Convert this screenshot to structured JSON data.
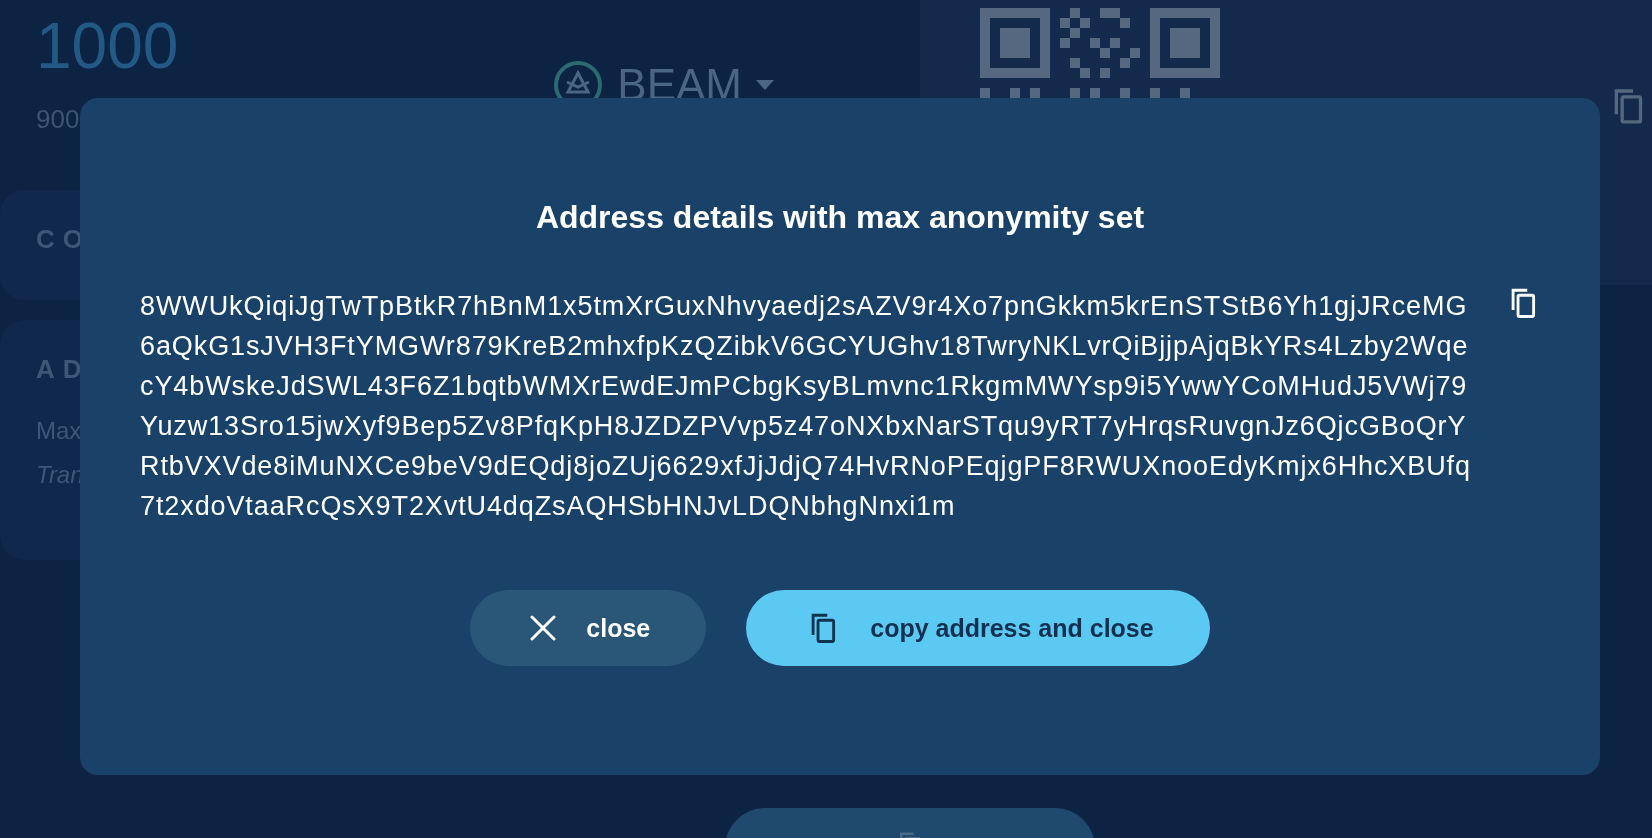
{
  "background": {
    "amount": "1000",
    "amount_secondary": "900",
    "currency": "BEAM",
    "section_1_title": "CO",
    "section_2_title": "AD",
    "section_2_label": "Max",
    "section_2_note": "Tran"
  },
  "dialog": {
    "title": "Address details with max anonymity set",
    "address": "8WWUkQiqiJgTwTpBtkR7hBnM1x5tmXrGuxNhvyaedj2sAZV9r4Xo7pnGkkm5krEnSTStB6Yh1gjJRceMG6aQkG1sJVH3FtYMGWr879KreB2mhxfpKzQZibkV6GCYUGhv18TwryNKLvrQiBjjpAjqBkYRs4Lzby2WqecY4bWskeJdSWL43F6Z1bqtbWMXrEwdEJmPCbgKsyBLmvnc1RkgmMWYsp9i5YwwYCoMHudJ5VWj79Yuzw13Sro15jwXyf9Bep5Zv8PfqKpH8JZDZPVvp5z47oNXbxNarSTqu9yRT7yHrqsRuvgnJz6QjcGBoQrYRtbVXVde8iMuNXCe9beV9dEQdj8joZUj6629xfJjJdjQ74HvRNoPEqjgPF8RWUXnooEdyKmjx6HhcXBUfq7t2xdoVtaaRcQsX9T2XvtU4dqZsAQHSbHNJvLDQNbhgNnxi1m",
    "buttons": [
      {
        "kind": "secondary",
        "label": "close"
      },
      {
        "kind": "primary",
        "label": "copy address and close"
      }
    ]
  }
}
